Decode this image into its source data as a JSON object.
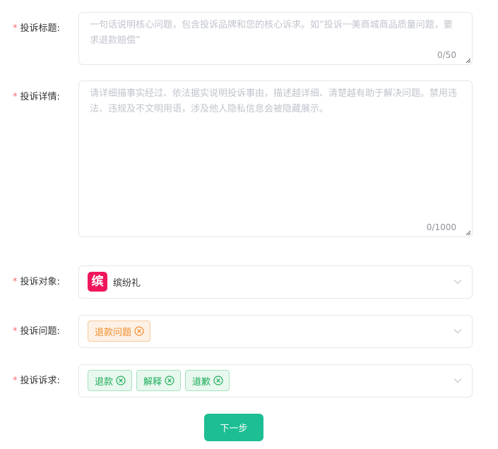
{
  "required_mark": "*",
  "title_field": {
    "label": "投诉标题:",
    "placeholder": "一句话说明核心问题，包含投诉品牌和您的核心诉求。如“投诉一美商城商品质量问题，要求退款赔偿”",
    "counter": "0/50"
  },
  "detail_field": {
    "label": "投诉详情:",
    "placeholder": "请详细描事实经过、依法据实说明投诉事由，描述越详细、清楚越有助于解决问题。禁用违法、违规及不文明用语，涉及他人隐私信息会被隐藏展示。",
    "counter": "0/1000"
  },
  "target_field": {
    "label": "投诉对象:",
    "brand_logo_text": "缤",
    "brand_name": "缤纷礼"
  },
  "issue_field": {
    "label": "投诉问题:",
    "tags": [
      "退款问题"
    ]
  },
  "demand_field": {
    "label": "投诉诉求:",
    "tags": [
      "退款",
      "解释",
      "道歉"
    ]
  },
  "next_button": "下一步",
  "colors": {
    "required": "#f56c6c",
    "primary": "#1dbe94",
    "brand_logo": "#f0165c",
    "issue_tag": "#f08c2c",
    "demand_tag": "#1fad5a"
  }
}
